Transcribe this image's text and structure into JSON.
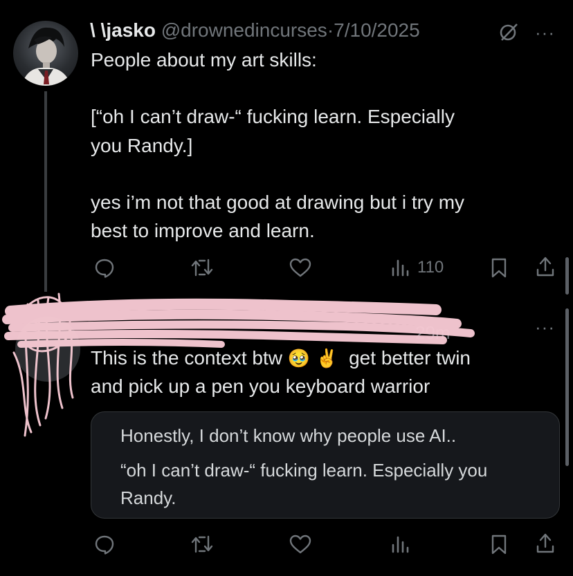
{
  "tweet1": {
    "display_name": "\\ \\jasko",
    "handle": "@drownedincurses",
    "separator": "·",
    "date": "7/10/2025",
    "more": "···",
    "lines": [
      "People about my art skills:",
      "[“oh I can’t draw-“ fucking learn. Especially",
      "you Randy.]",
      "yes i’m not that good at drawing but i try my",
      "best to improve and learn."
    ],
    "views": "110"
  },
  "tweet2": {
    "time": "29m",
    "more": "···",
    "line1_text": "This is the context btw",
    "emoji_pleading": "🥹",
    "emoji_victory": "✌",
    "line1_tail": "get better twin",
    "line2": "and pick up a pen you keyboard warrior",
    "quote": {
      "lines": [
        "Honestly, I don’t know why people use AI..",
        "“oh I can’t draw-“ fucking learn. Especially you",
        "Randy."
      ]
    }
  }
}
